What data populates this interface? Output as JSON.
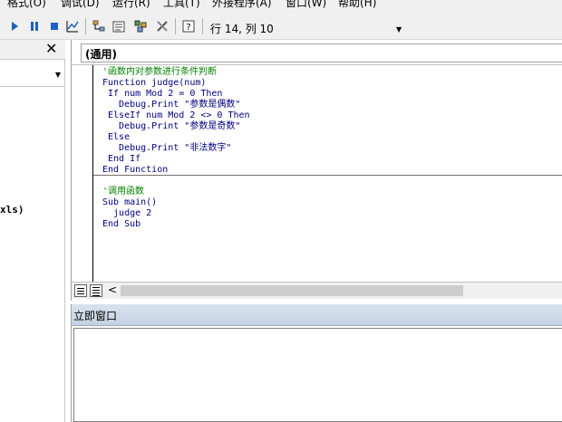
{
  "menubar": {
    "items": [
      "格式(O)",
      "调试(D)",
      "运行(R)",
      "工具(T)",
      "外接程序(A)",
      "窗口(W)",
      "帮助(H)"
    ]
  },
  "toolbar": {
    "cursor_position": "行 14, 列 10",
    "icons": [
      "run-icon",
      "pause-icon",
      "stop-icon",
      "design-mode-icon",
      "project-explorer-icon",
      "properties-icon",
      "object-browser-icon",
      "toolbox-icon",
      "help-icon"
    ]
  },
  "left_pane": {
    "close_glyph": "✕",
    "file_fragment": "xls)"
  },
  "code_window": {
    "object_combo": "(通用)",
    "lines": [
      "'函数内对参数进行条件判断",
      "Function judge(num)",
      " If num Mod 2 = 0 Then",
      "   Debug.Print \"参数是偶数\"",
      " ElseIf num Mod 2 <> 0 Then",
      "   Debug.Print \"参数是奇数\"",
      " Else",
      "   Debug.Print \"非法数字\"",
      " End If",
      "End Function",
      "",
      "'调用函数",
      "Sub main()",
      "  judge 2",
      "End Sub"
    ],
    "scroll_left_glyph": "<"
  },
  "immediate_window": {
    "title": "立即窗口"
  },
  "colors": {
    "keyword": "#000080",
    "comment": "#008000",
    "toolbar_bg": "#f0f0f0"
  }
}
